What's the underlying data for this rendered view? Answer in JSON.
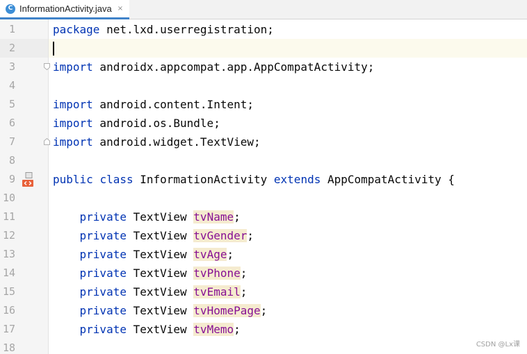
{
  "tab": {
    "icon_letter": "C",
    "title": "InformationActivity.java",
    "close_glyph": "×"
  },
  "lines": [
    {
      "num": "1",
      "parts": [
        {
          "t": "package",
          "c": "kw"
        },
        {
          "t": " net.lxd.userregistration;"
        }
      ]
    },
    {
      "num": "2",
      "parts": [],
      "current": true
    },
    {
      "num": "3",
      "parts": [
        {
          "t": "import",
          "c": "kw"
        },
        {
          "t": " androidx.appcompat.app.AppCompatActivity;"
        }
      ],
      "fold": "start"
    },
    {
      "num": "4",
      "parts": []
    },
    {
      "num": "5",
      "parts": [
        {
          "t": "import",
          "c": "kw"
        },
        {
          "t": " android.content.Intent;"
        }
      ]
    },
    {
      "num": "6",
      "parts": [
        {
          "t": "import",
          "c": "kw"
        },
        {
          "t": " android.os.Bundle;"
        }
      ]
    },
    {
      "num": "7",
      "parts": [
        {
          "t": "import",
          "c": "kw"
        },
        {
          "t": " android.widget.TextView;"
        }
      ],
      "fold": "end"
    },
    {
      "num": "8",
      "parts": []
    },
    {
      "num": "9",
      "parts": [
        {
          "t": "public",
          "c": "kw"
        },
        {
          "t": " "
        },
        {
          "t": "class",
          "c": "kw"
        },
        {
          "t": " InformationActivity "
        },
        {
          "t": "extends",
          "c": "kw"
        },
        {
          "t": " AppCompatActivity {"
        }
      ],
      "gutter_icon": "class-layout-icon"
    },
    {
      "num": "10",
      "parts": []
    },
    {
      "num": "11",
      "parts": [
        {
          "t": "    "
        },
        {
          "t": "private",
          "c": "kw"
        },
        {
          "t": " TextView "
        },
        {
          "t": "tvName",
          "c": "fld"
        },
        {
          "t": ";"
        }
      ]
    },
    {
      "num": "12",
      "parts": [
        {
          "t": "    "
        },
        {
          "t": "private",
          "c": "kw"
        },
        {
          "t": " TextView "
        },
        {
          "t": "tvGender",
          "c": "fld"
        },
        {
          "t": ";"
        }
      ]
    },
    {
      "num": "13",
      "parts": [
        {
          "t": "    "
        },
        {
          "t": "private",
          "c": "kw"
        },
        {
          "t": " TextView "
        },
        {
          "t": "tvAge",
          "c": "fld"
        },
        {
          "t": ";"
        }
      ]
    },
    {
      "num": "14",
      "parts": [
        {
          "t": "    "
        },
        {
          "t": "private",
          "c": "kw"
        },
        {
          "t": " TextView "
        },
        {
          "t": "tvPhone",
          "c": "fld"
        },
        {
          "t": ";"
        }
      ]
    },
    {
      "num": "15",
      "parts": [
        {
          "t": "    "
        },
        {
          "t": "private",
          "c": "kw"
        },
        {
          "t": " TextView "
        },
        {
          "t": "tvEmail",
          "c": "fld"
        },
        {
          "t": ";"
        }
      ]
    },
    {
      "num": "16",
      "parts": [
        {
          "t": "    "
        },
        {
          "t": "private",
          "c": "kw"
        },
        {
          "t": " TextView "
        },
        {
          "t": "tvHomePage",
          "c": "fld"
        },
        {
          "t": ";"
        }
      ]
    },
    {
      "num": "17",
      "parts": [
        {
          "t": "    "
        },
        {
          "t": "private",
          "c": "kw"
        },
        {
          "t": " TextView "
        },
        {
          "t": "tvMemo",
          "c": "fld"
        },
        {
          "t": ";"
        }
      ]
    },
    {
      "num": "18",
      "parts": []
    }
  ],
  "watermark": "CSDN @Lx课",
  "colors": {
    "keyword": "#0033b3",
    "field": "#871094",
    "field_highlight": "#f5ebcf",
    "tab_accent": "#4083c9",
    "current_line": "#fcfaed"
  }
}
